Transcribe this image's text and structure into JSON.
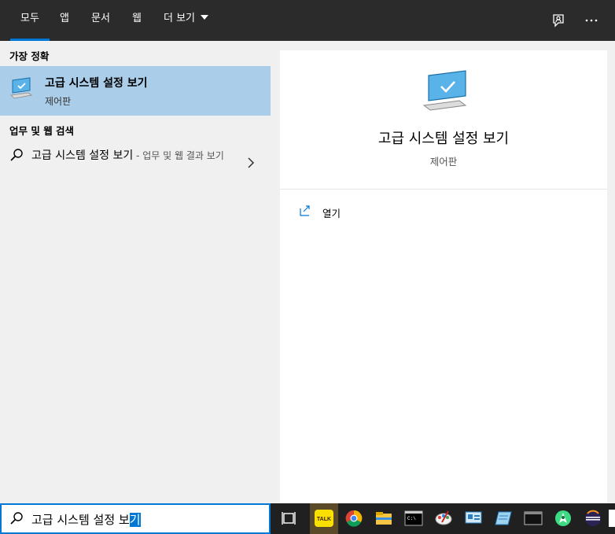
{
  "tabs": [
    {
      "label": "모두",
      "active": true
    },
    {
      "label": "앱"
    },
    {
      "label": "문서"
    },
    {
      "label": "웹"
    },
    {
      "label": "더 보기"
    }
  ],
  "top_icons": [
    "feedback-icon",
    "more-icon"
  ],
  "left": {
    "best_match_header": "가장 정확",
    "best_match": {
      "title": "고급 시스템 설정 보기",
      "subtitle": "제어판",
      "icon": "computer-monitor-icon"
    },
    "web_header": "업무 및 웹 검색",
    "web_item": {
      "text": "고급 시스템 설정 보기",
      "hint": " - 업무 및 웹 결과 보기"
    }
  },
  "right": {
    "title": "고급 시스템 설정 보기",
    "subtitle": "제어판",
    "actions": [
      {
        "label": "열기",
        "icon": "open-icon"
      }
    ]
  },
  "search": {
    "query_plain": "고급 시스템 설정 보",
    "query_selected": "기"
  },
  "taskbar": {
    "items": [
      "task-view-icon",
      "kakaotalk-icon",
      "chrome-icon",
      "file-explorer-icon",
      "terminal-icon",
      "paint-app-icon",
      "remote-desktop-icon",
      "notepad-app-icon",
      "console-app-icon",
      "android-studio-icon",
      "eclipse-icon",
      "notes-app-icon"
    ],
    "kakaotalk_label": "TALK"
  },
  "colors": {
    "accent": "#0078d7",
    "topbar": "#2b2b2b",
    "selection": "#aacdea",
    "taskbar": "#202020"
  }
}
